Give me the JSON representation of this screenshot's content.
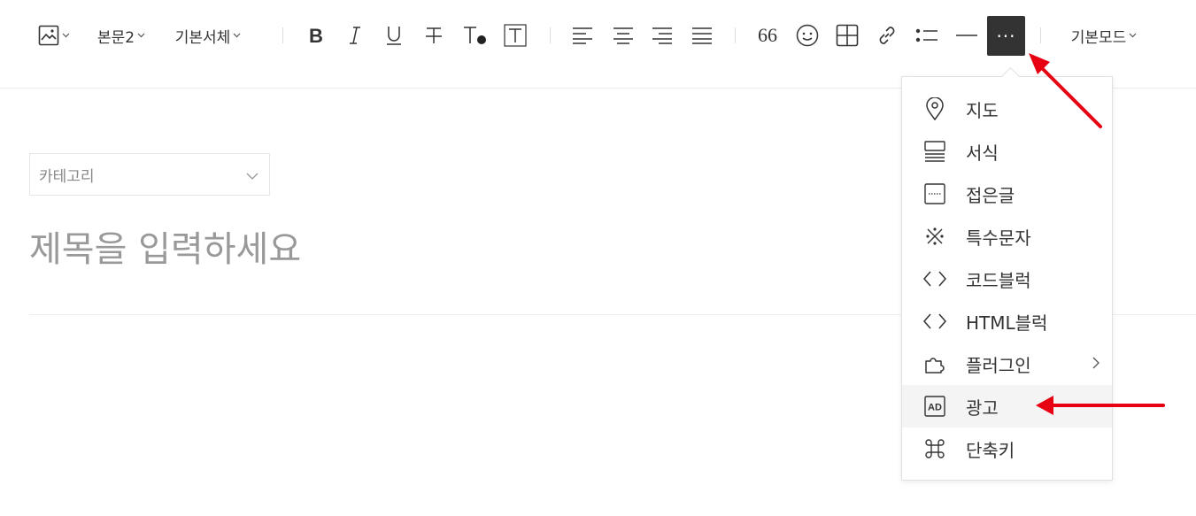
{
  "toolbar": {
    "paragraph_style": "본문2",
    "font_family": "기본서체",
    "mode": "기본모드",
    "quote_glyph": "66",
    "more_glyph": "···"
  },
  "editor": {
    "category_label": "카테고리",
    "title_placeholder": "제목을 입력하세요"
  },
  "more_menu": {
    "items": [
      {
        "label": "지도",
        "icon": "map-pin-icon"
      },
      {
        "label": "서식",
        "icon": "template-icon"
      },
      {
        "label": "접은글",
        "icon": "fold-text-icon"
      },
      {
        "label": "특수문자",
        "icon": "special-char-icon"
      },
      {
        "label": "코드블럭",
        "icon": "code-icon"
      },
      {
        "label": "HTML블럭",
        "icon": "html-code-icon"
      },
      {
        "label": "플러그인",
        "icon": "plugin-icon",
        "has_submenu": true
      },
      {
        "label": "광고",
        "icon": "ad-icon",
        "highlighted": true
      },
      {
        "label": "단축키",
        "icon": "command-key-icon"
      }
    ]
  },
  "colors": {
    "annotation_arrow": "#e60012",
    "active_button_bg": "#333333",
    "menu_hover_bg": "#f4f4f4"
  }
}
